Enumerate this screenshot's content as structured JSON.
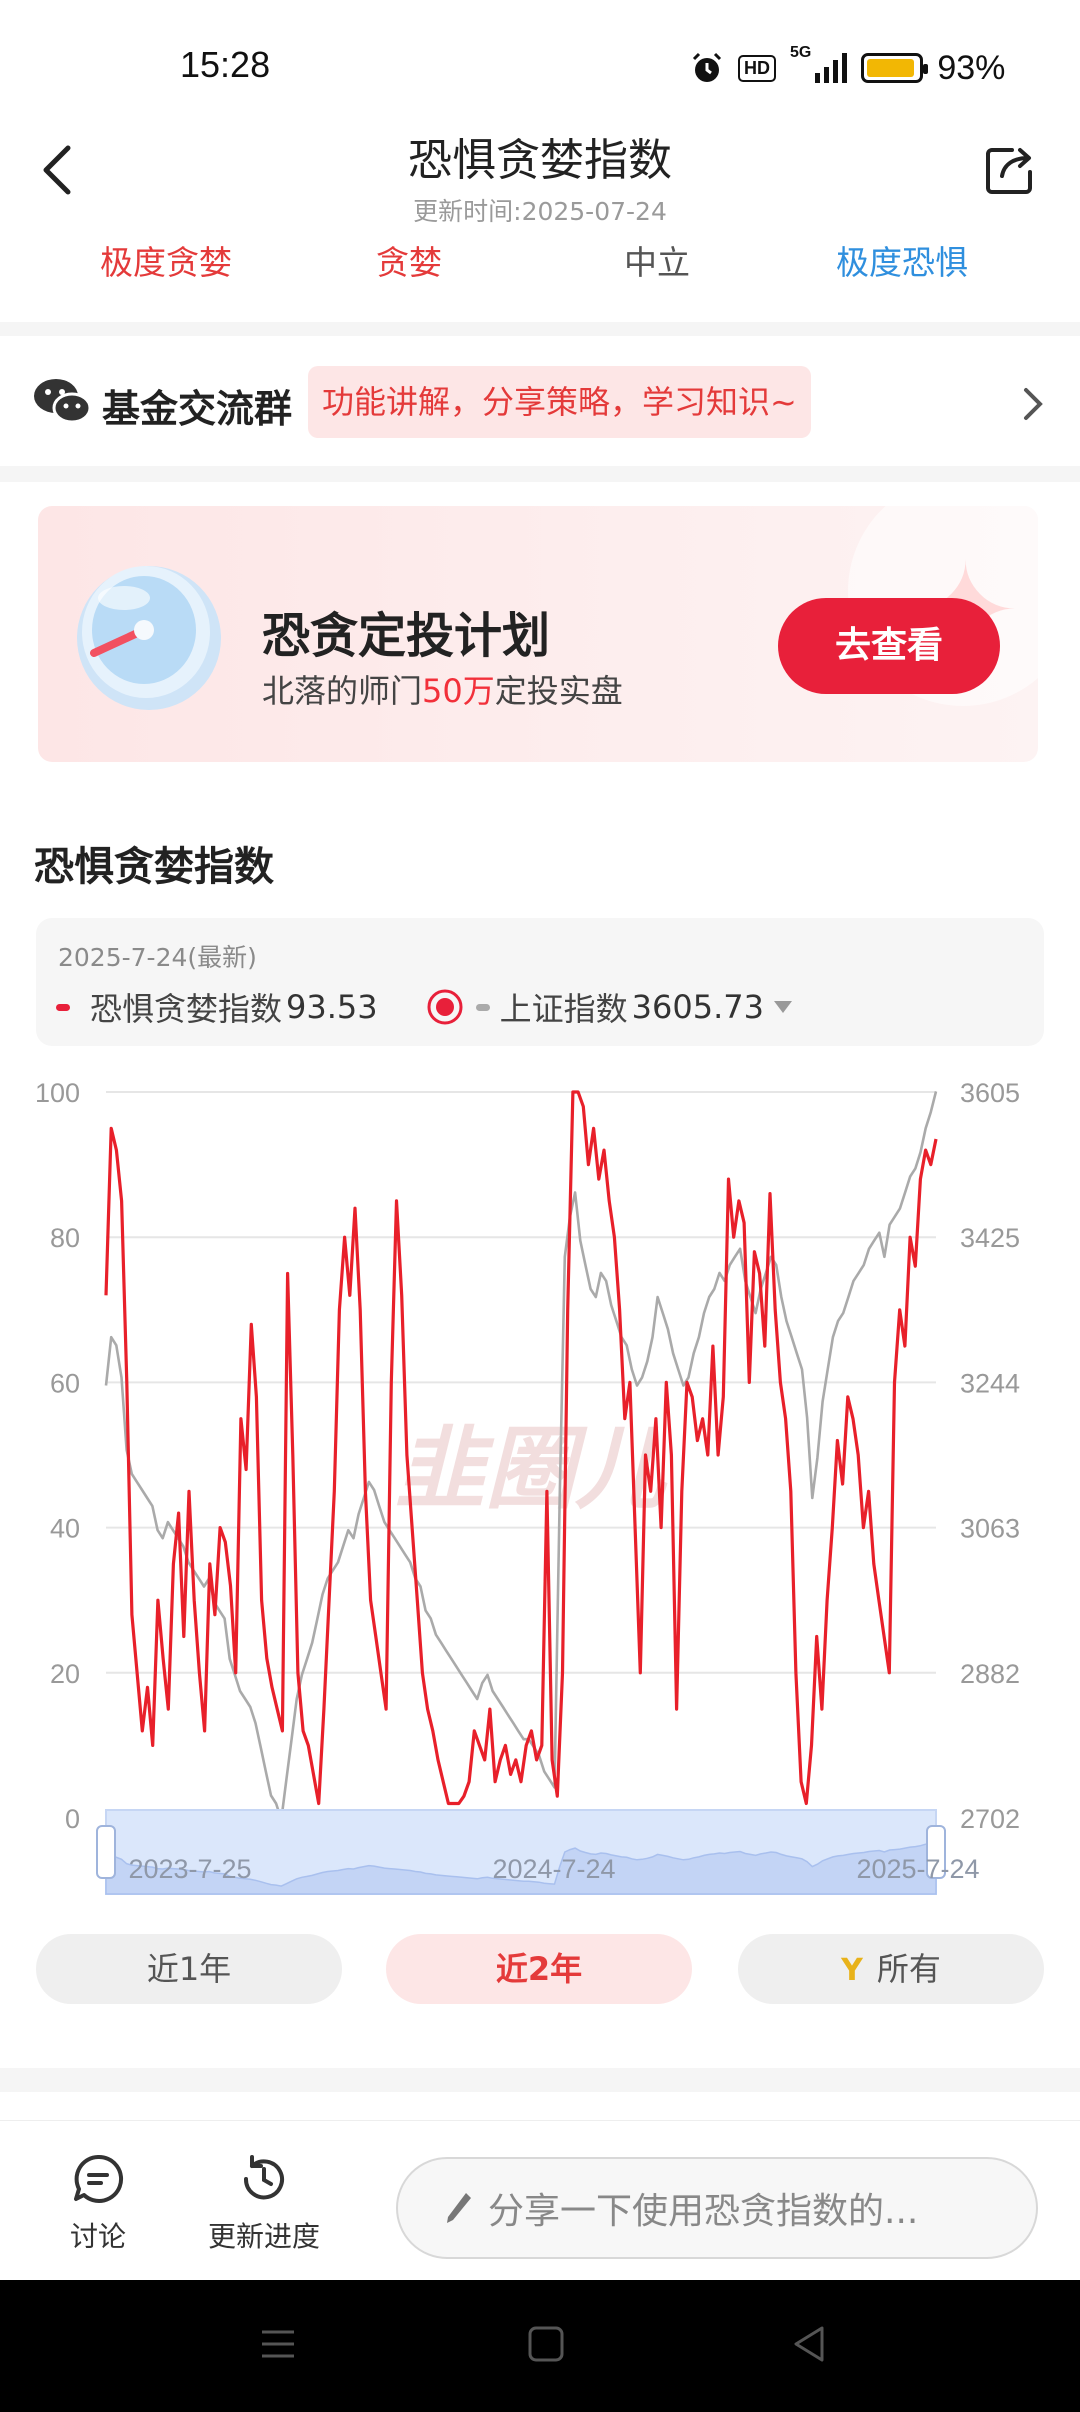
{
  "status_bar": {
    "time": "15:28",
    "hd_label": "HD",
    "network": "5G",
    "battery": "93%",
    "battery_level": 0.93
  },
  "header": {
    "title": "恐惧贪婪指数",
    "subtitle": "更新时间:2025-07-24"
  },
  "sentiment_levels": [
    {
      "label": "极度贪婪",
      "color": "#e43a3a"
    },
    {
      "label": "贪婪",
      "color": "#e43a3a"
    },
    {
      "label": "中立",
      "color": "#555555"
    },
    {
      "label": "极度恐惧",
      "color": "#2f8fde"
    }
  ],
  "group": {
    "title": "基金交流群",
    "tag": "功能讲解，分享策略，学习知识~"
  },
  "banner": {
    "title": "恐贪定投计划",
    "subtitle_pre": "北落的师门",
    "subtitle_highlight": "50万",
    "subtitle_post": "定投实盘",
    "button": "去查看"
  },
  "section": {
    "title": "恐惧贪婪指数"
  },
  "info": {
    "date": "2025-7-24(最新)",
    "series1_label": "恐惧贪婪指数",
    "series1_value": "93.53",
    "series2_label": "上证指数",
    "series2_value": "3605.73"
  },
  "chart_data": {
    "type": "line",
    "watermark": "韭圈儿",
    "y_left_ticks": [
      "100",
      "80",
      "60",
      "40",
      "20",
      "0"
    ],
    "y_left_range": [
      0,
      100
    ],
    "y_right_ticks": [
      "3605",
      "3425",
      "3244",
      "3063",
      "2882",
      "2702"
    ],
    "y_right_range": [
      2702,
      3605
    ],
    "x_labels": [
      "2023-7-25",
      "2024-7-24",
      "2025-7-24"
    ],
    "grid": true,
    "series": [
      {
        "name": "恐惧贪婪指数",
        "color": "#e8202a",
        "axis": "left",
        "values": [
          72,
          95,
          92,
          85,
          60,
          28,
          20,
          12,
          18,
          10,
          30,
          22,
          15,
          35,
          42,
          25,
          45,
          30,
          20,
          12,
          35,
          28,
          40,
          38,
          32,
          20,
          55,
          48,
          68,
          58,
          30,
          22,
          18,
          15,
          12,
          75,
          50,
          20,
          12,
          10,
          6,
          2,
          15,
          30,
          45,
          70,
          80,
          72,
          84,
          70,
          45,
          30,
          25,
          20,
          15,
          60,
          85,
          72,
          50,
          40,
          30,
          20,
          15,
          12,
          8,
          5,
          2,
          2,
          2,
          3,
          5,
          12,
          10,
          8,
          15,
          5,
          8,
          10,
          6,
          8,
          5,
          10,
          12,
          8,
          10,
          45,
          8,
          3,
          20,
          70,
          100,
          100,
          98,
          90,
          95,
          88,
          92,
          85,
          80,
          70,
          55,
          60,
          40,
          20,
          50,
          45,
          55,
          40,
          60,
          50,
          15,
          45,
          60,
          58,
          52,
          55,
          50,
          65,
          50,
          58,
          88,
          80,
          85,
          82,
          60,
          78,
          75,
          65,
          86,
          70,
          60,
          55,
          45,
          20,
          5,
          2,
          10,
          25,
          15,
          30,
          40,
          52,
          46,
          58,
          55,
          50,
          40,
          45,
          35,
          30,
          25,
          20,
          60,
          70,
          65,
          80,
          76,
          88,
          92,
          90,
          93.53
        ]
      },
      {
        "name": "上证指数",
        "color": "#aaaaaa",
        "axis": "right",
        "values": [
          3240,
          3300,
          3290,
          3250,
          3160,
          3130,
          3120,
          3110,
          3100,
          3090,
          3060,
          3050,
          3070,
          3060,
          3050,
          3040,
          3020,
          3010,
          3000,
          2990,
          3000,
          2970,
          2960,
          2950,
          2900,
          2880,
          2860,
          2850,
          2840,
          2820,
          2790,
          2760,
          2730,
          2720,
          2700,
          2750,
          2800,
          2850,
          2880,
          2900,
          2920,
          2950,
          2980,
          3000,
          3010,
          3020,
          3040,
          3060,
          3050,
          3080,
          3100,
          3120,
          3110,
          3090,
          3070,
          3060,
          3050,
          3040,
          3030,
          3020,
          3000,
          2990,
          2960,
          2950,
          2930,
          2920,
          2910,
          2900,
          2890,
          2880,
          2870,
          2860,
          2850,
          2870,
          2880,
          2860,
          2850,
          2840,
          2830,
          2820,
          2810,
          2800,
          2800,
          2790,
          2780,
          2760,
          2750,
          2740,
          3100,
          3400,
          3450,
          3480,
          3420,
          3390,
          3360,
          3350,
          3380,
          3370,
          3340,
          3320,
          3300,
          3290,
          3260,
          3240,
          3250,
          3270,
          3300,
          3350,
          3330,
          3310,
          3280,
          3260,
          3240,
          3250,
          3280,
          3300,
          3330,
          3350,
          3360,
          3380,
          3370,
          3390,
          3400,
          3410,
          3370,
          3350,
          3330,
          3360,
          3380,
          3400,
          3390,
          3350,
          3320,
          3300,
          3280,
          3260,
          3200,
          3100,
          3150,
          3220,
          3260,
          3300,
          3320,
          3330,
          3350,
          3370,
          3380,
          3390,
          3410,
          3420,
          3430,
          3400,
          3440,
          3450,
          3460,
          3480,
          3500,
          3510,
          3530,
          3560,
          3580,
          3605.73
        ]
      }
    ]
  },
  "range_buttons": {
    "btn1": "近1年",
    "btn2": "近2年",
    "btn3": "所有"
  },
  "bottom": {
    "discuss": "讨论",
    "update": "更新进度",
    "input_placeholder": "分享一下使用恐贪指数的..."
  }
}
